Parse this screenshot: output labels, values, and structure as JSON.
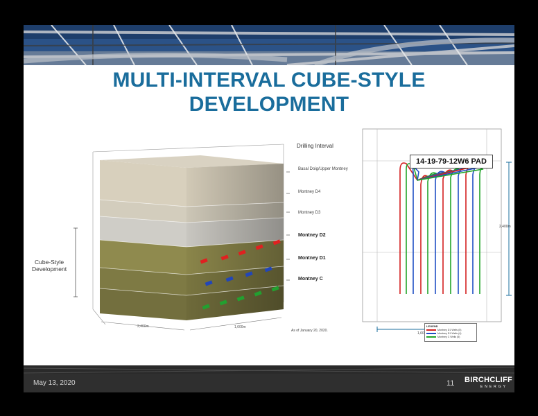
{
  "slide": {
    "title_line1": "MULTI-INTERVAL CUBE-STYLE",
    "title_line2": "DEVELOPMENT"
  },
  "cube_diagram": {
    "header": "Drilling Interval",
    "intervals": [
      {
        "label": "Basal Doig/Upper Montney",
        "bold": false
      },
      {
        "label": "Montney D4",
        "bold": false
      },
      {
        "label": "Montney D3",
        "bold": false
      },
      {
        "label": "Montney D2",
        "bold": true
      },
      {
        "label": "Montney D1",
        "bold": true
      },
      {
        "label": "Montney C",
        "bold": true
      }
    ],
    "cube_style_label_line1": "Cube-Style",
    "cube_style_label_line2": "Development",
    "dim_front": "2,400m",
    "dim_side": "1,600m",
    "as_of": "As of January 20, 2020."
  },
  "pad_diagram": {
    "title": "14-19-79-12W6 PAD",
    "depth_label": "2,400m",
    "width_label": "1,600m",
    "legend": {
      "title": "LEGEND",
      "items": [
        {
          "label": "Montney D1 Wells (5)",
          "color": "#d42020"
        },
        {
          "label": "Montney D1 Wells (4)",
          "color": "#1f4fc4"
        },
        {
          "label": "Montney C Wells (5)",
          "color": "#22a52a"
        }
      ]
    }
  },
  "footer": {
    "date": "May 13, 2020",
    "page": "11",
    "logo_main": "BIRCHCLIFF",
    "logo_sub": "ENERGY"
  },
  "colors": {
    "title": "#1a6d9c",
    "d2_wells": "#d42020",
    "d1_wells": "#1f4fc4",
    "c_wells": "#22a52a",
    "guide": "#1a6d9c"
  }
}
